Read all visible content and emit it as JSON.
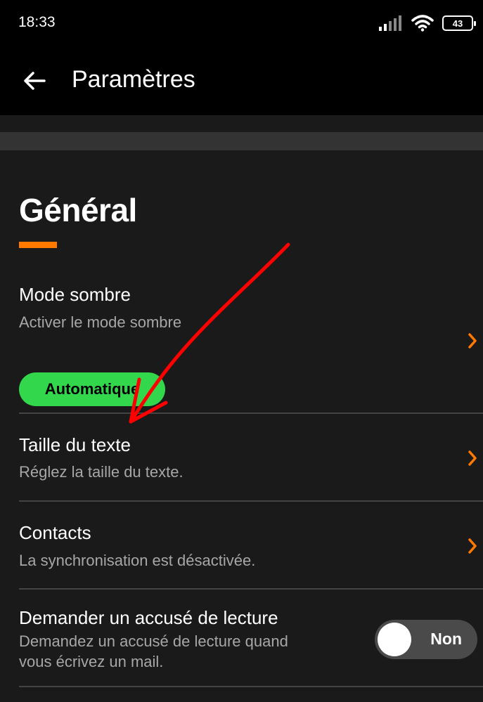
{
  "status_bar": {
    "time": "18:33",
    "battery_level": "43",
    "icons": [
      "signal-icon",
      "wifi-icon",
      "battery-icon"
    ]
  },
  "app_bar": {
    "back_icon": "arrow-left-icon",
    "title": "Paramètres"
  },
  "section": {
    "title": "Général",
    "accent_color": "#ff7900"
  },
  "settings": {
    "dark_mode": {
      "title": "Mode sombre",
      "subtitle": "Activer le mode sombre",
      "badge": "Automatique",
      "badge_color": "#32d74b"
    },
    "text_size": {
      "title": "Taille du texte",
      "subtitle": "Réglez la taille du texte."
    },
    "contacts": {
      "title": "Contacts",
      "subtitle": "La synchronisation est désactivée."
    },
    "read_receipt": {
      "title": "Demander un accusé de lecture",
      "subtitle_line1": "Demandez un accusé de lecture quand",
      "subtitle_line2": "vous écrivez un mail.",
      "toggle_label": "Non",
      "toggle_on": false
    }
  },
  "colors": {
    "background": "#1a1a1a",
    "chevron": "#ff7900",
    "annotation_arrow": "#ff0000"
  }
}
